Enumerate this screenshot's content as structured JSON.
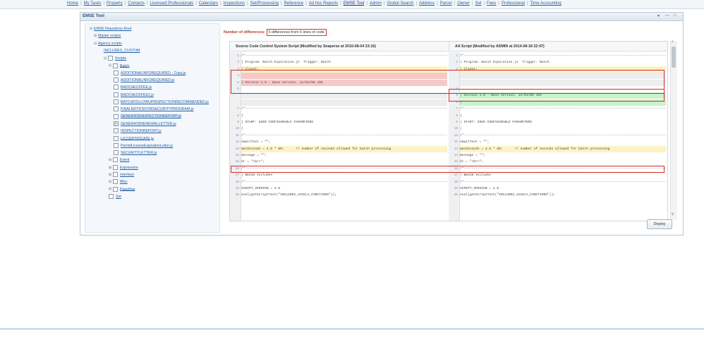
{
  "nav": {
    "items": [
      "Home",
      "My Tasks",
      "Property",
      "Contacts",
      "Licensed Professionals",
      "Calendars",
      "Inspections",
      "Set/Processing",
      "Reference",
      "Ad hoc Reports",
      "EMSE Tool",
      "Admin",
      "Global Search",
      "Address",
      "Parcel",
      "Owner",
      "Set",
      "Fees",
      "Professional",
      "Time Accounting"
    ],
    "active": "EMSE Tool"
  },
  "window": {
    "title": "EMSE Tool",
    "controls": [
      "▾",
      "—",
      "□"
    ]
  },
  "tree": [
    {
      "label": "EMSE Repository Root",
      "pm": "⊟",
      "cb": false
    },
    {
      "label": "Master scripts",
      "pm": "⊞",
      "cb": false
    },
    {
      "label": "Agency scripts",
      "pm": "⊟",
      "cb": false
    },
    {
      "label": "INCLUDES_CUSTOM",
      "pm": "",
      "cb": false
    },
    {
      "label": "Scripts",
      "pm": "⊟",
      "cb": true
    },
    {
      "label": "Batch",
      "pm": "⊟",
      "cb": true
    },
    {
      "label": "ADDITIONALINFOREQUIRED - Copy.js",
      "pm": "",
      "cb": true
    },
    {
      "label": "ADDITIONALINFOREQUIRED.js",
      "pm": "",
      "cb": true
    },
    {
      "label": "BADCHECKFEE.js",
      "pm": "",
      "cb": true
    },
    {
      "label": "BADCHECKFEE2.js",
      "pm": "",
      "cb": true
    },
    {
      "label": "BATCHFOLLOWUPINSPECTIONRECOMMENDED.js",
      "pm": "",
      "cb": true
    },
    {
      "label": "FINALNOTICEFORSECURITYPROGRAM.js",
      "pm": "",
      "cb": true
    },
    {
      "label": "GENERATEINSPECTIONREPORT.js",
      "pm": "",
      "cb": true,
      "selected": true
    },
    {
      "label": "GENERATERENEWALLETTER.js",
      "pm": "",
      "cb": true,
      "checked": true
    },
    {
      "label": "INSPECTIONREPORT.js",
      "pm": "",
      "cb": true
    },
    {
      "label": "LICCERTIFICATE.js",
      "pm": "",
      "cb": true
    },
    {
      "label": "PermitLicenseExpirationLetter.js",
      "pm": "",
      "cb": true
    },
    {
      "label": "SECURITYLETTER.js",
      "pm": "",
      "cb": true
    },
    {
      "label": "Event",
      "pm": "⊞",
      "cb": true
    },
    {
      "label": "Expression",
      "pm": "⊞",
      "cb": true
    },
    {
      "label": "Interface",
      "pm": "⊞",
      "cb": true
    },
    {
      "label": "Misc",
      "pm": "⊞",
      "cb": true
    },
    {
      "label": "Pageflow",
      "pm": "⊞",
      "cb": true
    },
    {
      "label": "Set",
      "pm": "",
      "cb": true
    }
  ],
  "diff": {
    "summary_label": "Number of differences:",
    "summary_value": "5 differences from 5 lines of code"
  },
  "left": {
    "header": "Source Code Control System Script (Modified by Seaperse at 2016-08-04 23:16)",
    "lines": [
      {
        "n": "1",
        "t": "/*------------------------------------------------------------------------------------------------------------",
        "c": ""
      },
      {
        "n": "2",
        "t": "| Program: Batch Expiration.js  Trigger: Batch",
        "c": ""
      },
      {
        "n": "3",
        "t": "| Client:",
        "c": "yellow"
      },
      {
        "n": "4",
        "t": "",
        "c": "red"
      },
      {
        "n": "5",
        "t": "| Version 1.0 - Base Version. 11/01/08 JHS",
        "c": "red"
      },
      {
        "n": "6",
        "t": "",
        "c": ""
      },
      {
        "n": "",
        "t": "",
        "c": "gray"
      },
      {
        "n": "",
        "t": "",
        "c": "gray"
      },
      {
        "n": "7",
        "t": "/*------------------------------------------------------------------------------------------------------------",
        "c": ""
      },
      {
        "n": "8",
        "t": "|",
        "c": ""
      },
      {
        "n": "9",
        "t": "| START: USER CONFIGURABLE PARAMETERS",
        "c": ""
      },
      {
        "n": "10",
        "t": "|",
        "c": ""
      },
      {
        "n": "11",
        "t": "/*------------------------------------------------------------------------------------------------------------",
        "c": ""
      },
      {
        "n": "12",
        "t": "emailText = \"\";",
        "c": ""
      },
      {
        "n": "13",
        "t": "maxSeconds = 4.5 * 60;      // number of seconds allowed for batch processing",
        "c": "yellow"
      },
      {
        "n": "14",
        "t": "message = \"\";",
        "c": ""
      },
      {
        "n": "15",
        "t": "br = \"<br>\";",
        "c": ""
      },
      {
        "n": "16",
        "t": "/*------------------------------------------------------------------------------------------------------------",
        "c": ""
      },
      {
        "n": "17",
        "t": "| BEGIN Includes",
        "c": ""
      },
      {
        "n": "18",
        "t": "/*------------------------------------------------------------------------------------------------------------",
        "c": ""
      },
      {
        "n": "19",
        "t": "SCRIPT_VERSION = 2.0",
        "c": ""
      },
      {
        "n": "20",
        "t": "eval(getScriptText(\"INCLUDES_ACCELA_FUNCTIONS\"));",
        "c": ""
      }
    ]
  },
  "right": {
    "header": "AA Script (Modified by ADMIN at 2014-08-18 22:47)",
    "lines": [
      {
        "n": "1",
        "t": "/*------------------------------------------------------------------------------------------------------------",
        "c": ""
      },
      {
        "n": "2",
        "t": "| Program: Batch Expiration.js  Trigger: Batch",
        "c": ""
      },
      {
        "n": "3",
        "t": "| Client:",
        "c": "yellow"
      },
      {
        "n": "",
        "t": "",
        "c": "gray"
      },
      {
        "n": "",
        "t": "",
        "c": "gray"
      },
      {
        "n": "4",
        "t": "",
        "c": ""
      },
      {
        "n": "5",
        "t": "| Version 1.0 - Base Version. 11/01/08 JHS",
        "c": "green"
      },
      {
        "n": "6",
        "t": "|",
        "c": "green"
      },
      {
        "n": "7",
        "t": "/*------------------------------------------------------------------------------------------------------------",
        "c": ""
      },
      {
        "n": "8",
        "t": "|",
        "c": ""
      },
      {
        "n": "9",
        "t": "| START: USER CONFIGURABLE PARAMETERS",
        "c": ""
      },
      {
        "n": "10",
        "t": "|",
        "c": ""
      },
      {
        "n": "11",
        "t": "/*------------------------------------------------------------------------------------------------------------",
        "c": ""
      },
      {
        "n": "12",
        "t": "emailText = \"\";",
        "c": ""
      },
      {
        "n": "13",
        "t": "maxSeconds = 4.5 * 60;      // number of seconds allowed for batch processing",
        "c": "yellow"
      },
      {
        "n": "14",
        "t": "message = \"\";",
        "c": ""
      },
      {
        "n": "15",
        "t": "br = \"<br>\";",
        "c": ""
      },
      {
        "n": "16",
        "t": "/*------------------------------------------------------------------------------------------------------------",
        "c": ""
      },
      {
        "n": "17",
        "t": "| BEGIN Includes",
        "c": ""
      },
      {
        "n": "18",
        "t": "/*------------------------------------------------------------------------------------------------------------",
        "c": ""
      },
      {
        "n": "19",
        "t": "SCRIPT_VERSION = 2.0",
        "c": ""
      },
      {
        "n": "20",
        "t": "eval(getScriptText(\"INCLUDES_ACCELA_FUNCTIONS\"));",
        "c": ""
      }
    ]
  },
  "buttons": {
    "deploy": "Deploy"
  },
  "icons": {
    "scroll_up": "chevron-up-icon",
    "scroll_down": "chevron-down-icon"
  }
}
